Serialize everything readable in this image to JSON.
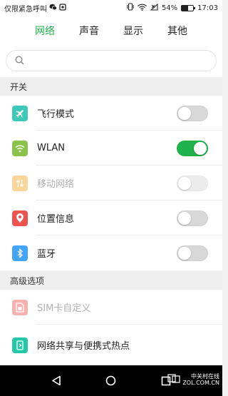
{
  "status_bar": {
    "left_text": "仅限紧急呼叫",
    "battery": "54%",
    "battery_level": 0.54,
    "time": "17:03"
  },
  "tabs": [
    {
      "label": "网络",
      "active": true
    },
    {
      "label": "声音",
      "active": false
    },
    {
      "label": "显示",
      "active": false
    },
    {
      "label": "其他",
      "active": false
    }
  ],
  "search": {
    "placeholder": ""
  },
  "sections": {
    "switches": "开关",
    "advanced": "高级选项"
  },
  "rows": {
    "airplane": {
      "label": "飞行模式",
      "state": "off",
      "icon": "airplane-icon",
      "color": "#3ec8b8"
    },
    "wlan": {
      "label": "WLAN",
      "state": "on",
      "icon": "wifi-icon",
      "color": "#8bc34a"
    },
    "mobile": {
      "label": "移动网络",
      "state": "disabled-off",
      "icon": "mobile-data-icon",
      "color": "#f5a623"
    },
    "location": {
      "label": "位置信息",
      "state": "off",
      "icon": "location-pin-icon",
      "color": "#ef5350"
    },
    "bluetooth": {
      "label": "蓝牙",
      "state": "off",
      "icon": "bluetooth-icon",
      "color": "#42a5f5"
    },
    "sim": {
      "label": "SIM卡自定义",
      "disabled": true,
      "icon": "sim-card-icon",
      "color": "#ef5350"
    },
    "hotspot": {
      "label": "网络共享与便携式热点",
      "icon": "hotspot-icon",
      "color": "#26c6a8"
    }
  },
  "watermark": {
    "line1": "中关村在线",
    "line2": "ZOL.COM.CN"
  },
  "colors": {
    "accent": "#1fb14c"
  }
}
